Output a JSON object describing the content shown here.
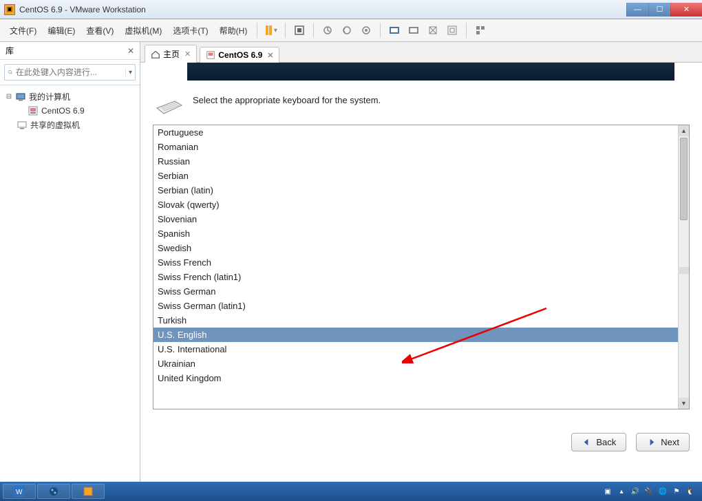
{
  "window": {
    "title": "CentOS 6.9 - VMware Workstation"
  },
  "menu": {
    "file": "文件(F)",
    "edit": "编辑(E)",
    "view": "查看(V)",
    "vm": "虚拟机(M)",
    "tabs": "选项卡(T)",
    "help": "帮助(H)"
  },
  "sidebar": {
    "title": "库",
    "search_placeholder": "在此处键入内容进行...",
    "root": "我的计算机",
    "vm_child": "CentOS 6.9",
    "shared": "共享的虚拟机"
  },
  "tabs": {
    "home": "主页",
    "vm": "CentOS 6.9"
  },
  "installer": {
    "prompt": "Select the appropriate keyboard for the system.",
    "options": [
      "Portuguese",
      "Romanian",
      "Russian",
      "Serbian",
      "Serbian (latin)",
      "Slovak (qwerty)",
      "Slovenian",
      "Spanish",
      "Swedish",
      "Swiss French",
      "Swiss French (latin1)",
      "Swiss German",
      "Swiss German (latin1)",
      "Turkish",
      "U.S. English",
      "U.S. International",
      "Ukrainian",
      "United Kingdom"
    ],
    "selected": "U.S. English",
    "back": "Back",
    "next": "Next"
  }
}
